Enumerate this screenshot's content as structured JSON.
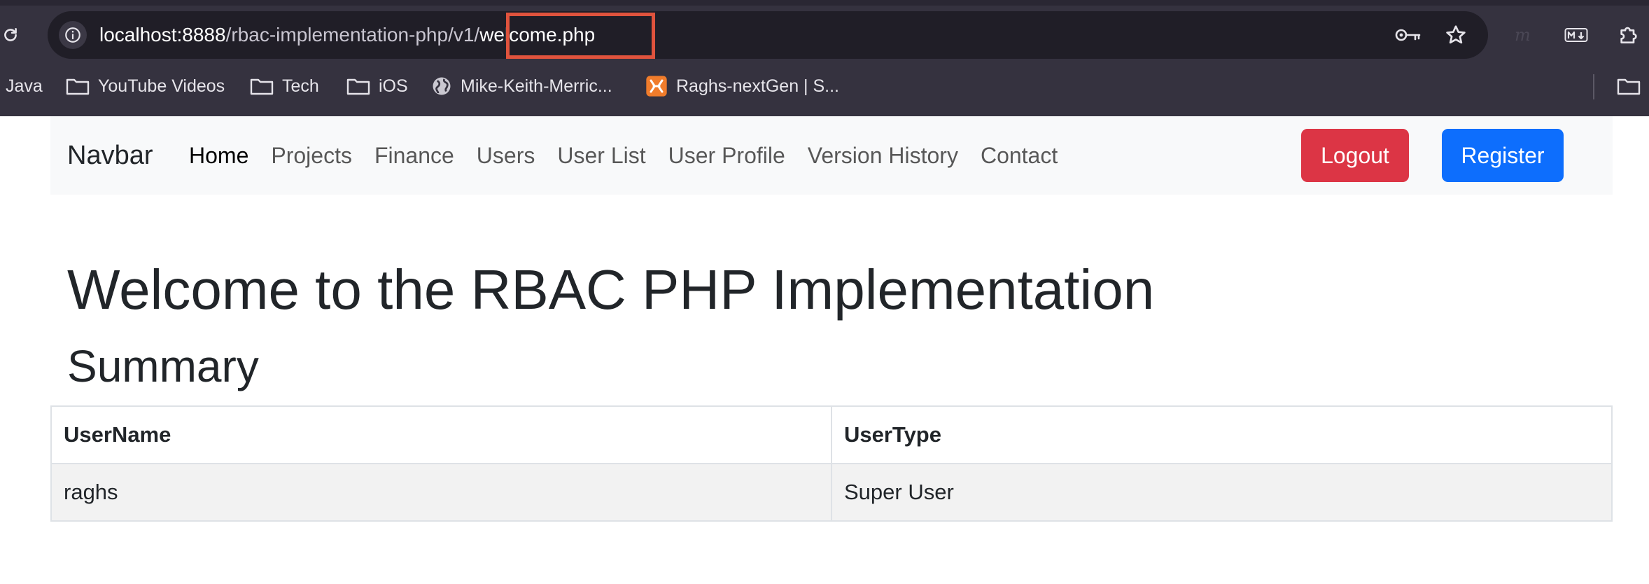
{
  "browser": {
    "url": {
      "host": "localhost:8888",
      "path": "/rbac-implementation-php/v1",
      "separator": "/",
      "page": "welcome.php"
    },
    "annotation_color": "#e0533d",
    "toolbar_icons": [
      "reload-icon",
      "site-info-icon",
      "key-icon",
      "star-icon",
      "m-extension-icon",
      "markdown-icon",
      "puzzle-extensions-icon"
    ],
    "bookmarks": [
      {
        "label": "Java",
        "icon": "none"
      },
      {
        "label": "YouTube Videos",
        "icon": "folder-icon"
      },
      {
        "label": "Tech",
        "icon": "folder-icon"
      },
      {
        "label": "iOS",
        "icon": "folder-icon"
      },
      {
        "label": "Mike-Keith-Merric...",
        "icon": "globe-icon"
      },
      {
        "label": "Raghs-nextGen | S...",
        "icon": "xampp-icon"
      }
    ]
  },
  "navbar": {
    "brand": "Navbar",
    "links": [
      {
        "label": "Home",
        "active": true
      },
      {
        "label": "Projects"
      },
      {
        "label": "Finance"
      },
      {
        "label": "Users"
      },
      {
        "label": "User List"
      },
      {
        "label": "User Profile"
      },
      {
        "label": "Version History"
      },
      {
        "label": "Contact"
      }
    ],
    "logout_label": "Logout",
    "register_label": "Register",
    "logout_color": "#dc3545",
    "register_color": "#0d6efd"
  },
  "main": {
    "title": "Welcome to the RBAC PHP Implementation",
    "subtitle": "Summary",
    "table": {
      "headers": [
        "UserName",
        "UserType"
      ],
      "rows": [
        [
          "raghs",
          "Super User"
        ]
      ]
    }
  }
}
